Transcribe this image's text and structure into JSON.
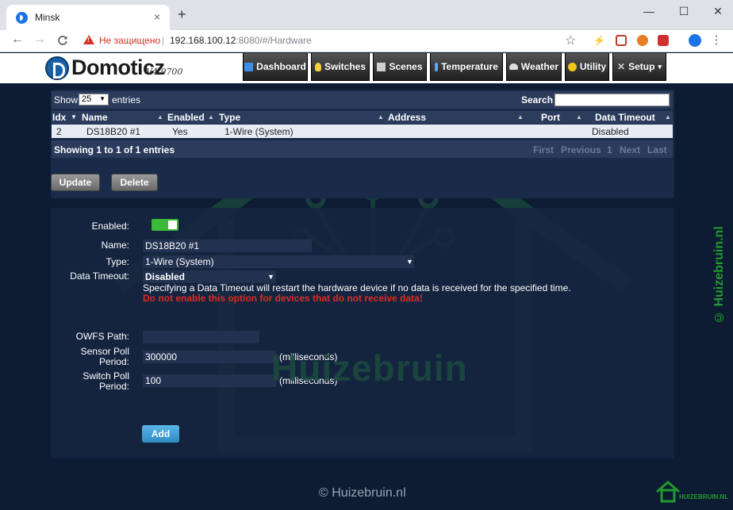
{
  "browser": {
    "tab_title": "Minsk",
    "tab_close": "×",
    "new_tab": "+",
    "minimize": "—",
    "maximize": "☐",
    "close": "✕",
    "back": "←",
    "forward": "→",
    "reload": "C",
    "insecure_label": "Не защищено",
    "separator": "|",
    "url_host": "192.168.100.12",
    "url_rest": ":8080/#/Hardware",
    "bookmark_star": "☆",
    "menu_dots": "⋮"
  },
  "app": {
    "brand": "Domoticz",
    "version": "V4.9700"
  },
  "menu": [
    {
      "label": "Dashboard",
      "icon": "dashboard-icon",
      "color": "#3a8ee6"
    },
    {
      "label": "Switches",
      "icon": "lightbulb-icon",
      "color": "#f4d03f"
    },
    {
      "label": "Scenes",
      "icon": "scenes-icon",
      "color": "#cfcfcf"
    },
    {
      "label": "Temperature",
      "icon": "thermometer-icon",
      "color": "#5da9e9"
    },
    {
      "label": "Weather",
      "icon": "cloud-icon",
      "color": "#dcdcdc"
    },
    {
      "label": "Utility",
      "icon": "utility-icon",
      "color": "#f0c419"
    },
    {
      "label": "Setup",
      "icon": "tools-icon",
      "color": "#cfcfcf",
      "caret": "▾"
    }
  ],
  "table": {
    "show_label": "Show",
    "show_value": "25",
    "entries_label": "entries",
    "search_label": "Search",
    "columns": [
      "Idx",
      "Name",
      "Enabled",
      "Type",
      "Address",
      "Port",
      "Data Timeout"
    ],
    "rows": [
      {
        "idx": "2",
        "name": "DS18B20 #1",
        "enabled": "Yes",
        "type": "1-Wire (System)",
        "address": "",
        "port": "",
        "data_timeout": "Disabled"
      }
    ],
    "info": "Showing 1 to 1 of 1 entries",
    "pager": {
      "first": "First",
      "previous": "Previous",
      "page": "1",
      "next": "Next",
      "last": "Last"
    }
  },
  "actions": {
    "update": "Update",
    "delete": "Delete"
  },
  "form": {
    "enabled_label": "Enabled:",
    "enabled": true,
    "name_label": "Name:",
    "name_value": "DS18B20 #1",
    "type_label": "Type:",
    "type_value": "1-Wire (System)",
    "timeout_label": "Data Timeout:",
    "timeout_value": "Disabled",
    "timeout_help": "Specifying a Data Timeout will restart the hardware device if no data is received for the specified time.",
    "timeout_warning": "Do not enable this option for devices that do not receive data!",
    "owfs_label": "OWFS Path:",
    "owfs_value": "",
    "sensor_poll_label_1": "Sensor Poll",
    "sensor_poll_label_2": "Period:",
    "sensor_poll_value": "300000",
    "switch_poll_label_1": "Switch Poll",
    "switch_poll_label_2": "Period:",
    "switch_poll_value": "100",
    "unit": "(milliseconds)",
    "add_label": "Add",
    "caret": "▼"
  },
  "watermark": {
    "center_text": "Huizebruin",
    "side_text": "© Huizebruin.nl",
    "copyright": "© Huizebruin.nl",
    "badge_text": "HUIZEBRUIN.NL"
  }
}
